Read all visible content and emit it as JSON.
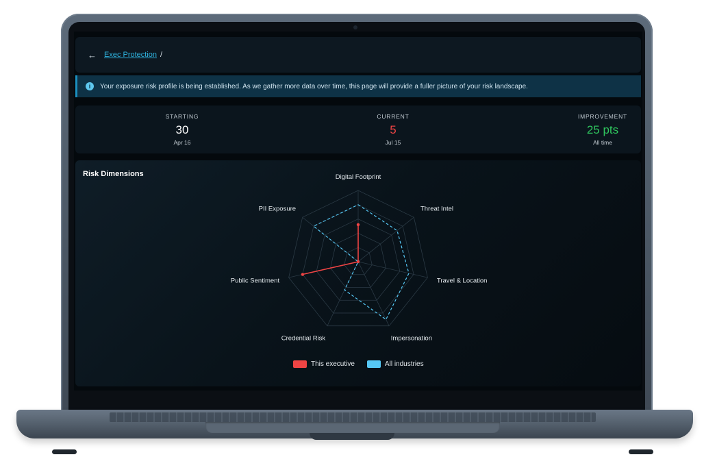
{
  "breadcrumb": {
    "link": "Exec Protection",
    "separator": "/"
  },
  "banner": {
    "text": "Your exposure risk profile is being established. As we gather more data over time, this page will provide a fuller picture of your risk landscape."
  },
  "stats": [
    {
      "label": "STARTING",
      "value": "30",
      "sub": "Apr 16",
      "color": "#ffffff"
    },
    {
      "label": "CURRENT",
      "value": "5",
      "sub": "Jul 15",
      "color": "#ef4444"
    },
    {
      "label": "IMPROVEMENT",
      "value": "25 pts",
      "sub": "All time",
      "color": "#2fc55e"
    }
  ],
  "radar": {
    "title": "Risk Dimensions",
    "axes": [
      "Digital Footprint",
      "Threat Intel",
      "Travel & Location",
      "Impersonation",
      "Credential Risk",
      "Public Sentiment",
      "PII Exposure"
    ],
    "max": 100,
    "levels": 5,
    "colors": {
      "executive": "#ef4444",
      "industries": "#56c8f5"
    }
  },
  "chart_data": {
    "type": "radar",
    "title": "Risk Dimensions",
    "categories": [
      "Digital Footprint",
      "Threat Intel",
      "Travel & Location",
      "Impersonation",
      "Credential Risk",
      "Public Sentiment",
      "PII Exposure"
    ],
    "series": [
      {
        "name": "This executive",
        "values": [
          52,
          0,
          0,
          0,
          0,
          80,
          0
        ]
      },
      {
        "name": "All industries",
        "values": [
          80,
          70,
          73,
          90,
          44,
          0,
          80
        ]
      }
    ],
    "legend": "bottom"
  },
  "legend": [
    {
      "label": "This executive",
      "color": "#ef4444"
    },
    {
      "label": "All industries",
      "color": "#56c8f5"
    }
  ]
}
